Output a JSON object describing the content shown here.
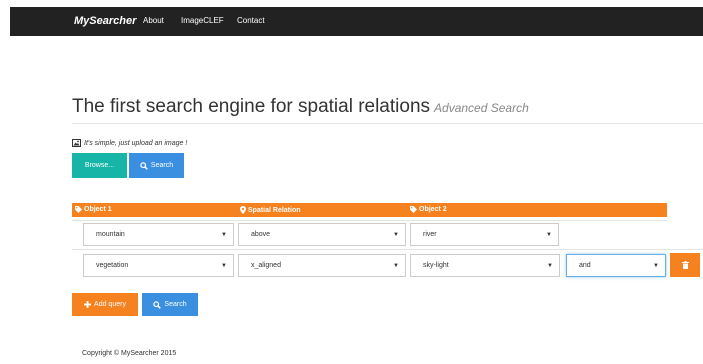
{
  "navbar": {
    "brand": "MySearcher",
    "links": [
      "About",
      "ImageCLEF",
      "Contact"
    ]
  },
  "header": {
    "title": "The first search engine for spatial relations",
    "subtitle": "Advanced Search"
  },
  "upload": {
    "note": "It's simple, just upload an image !",
    "browse_label": "Browse...",
    "search_label": "Search"
  },
  "query_table": {
    "headers": [
      "Object 1",
      "Spatial Relation",
      "Object 2"
    ],
    "rows": [
      {
        "object1": "mountain",
        "relation": "above",
        "object2": "river"
      },
      {
        "object1": "vegetation",
        "relation": "x_aligned",
        "object2": "sky-light",
        "connector": "and"
      }
    ]
  },
  "actions": {
    "add_query_label": "Add query",
    "search_label": "Search"
  },
  "footer": {
    "copyright": "Copyright © MySearcher 2015"
  },
  "colors": {
    "navbar": "#222222",
    "accent_orange": "#f5821f",
    "teal": "#17b4a8",
    "blue": "#3b8fe0"
  },
  "icons": {
    "image": "image-icon",
    "search": "search-icon",
    "tag": "tag-icon",
    "map_marker": "map-marker-icon",
    "plus": "plus-icon",
    "trash": "trash-icon",
    "caret": "caret-down-icon"
  }
}
